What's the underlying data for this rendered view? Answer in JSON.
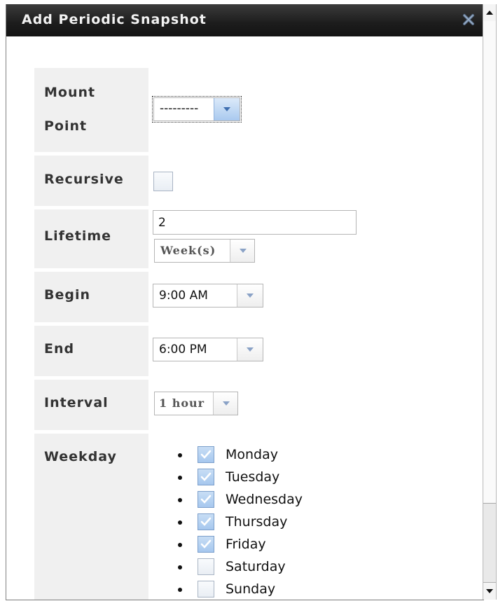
{
  "dialog": {
    "title": "Add Periodic Snapshot"
  },
  "form": {
    "mount_point": {
      "label_line1": "Mount",
      "label_line2": "Point",
      "value": "---------"
    },
    "recursive": {
      "label": "Recursive",
      "checked": false
    },
    "lifetime": {
      "label": "Lifetime",
      "value": "2",
      "unit": "Week(s)"
    },
    "begin": {
      "label": "Begin",
      "value": "9:00 AM"
    },
    "end": {
      "label": "End",
      "value": "6:00 PM"
    },
    "interval": {
      "label": "Interval",
      "value": "1 hour"
    },
    "weekday": {
      "label": "Weekday",
      "days": [
        {
          "name": "Monday",
          "checked": true
        },
        {
          "name": "Tuesday",
          "checked": true
        },
        {
          "name": "Wednesday",
          "checked": true
        },
        {
          "name": "Thursday",
          "checked": true
        },
        {
          "name": "Friday",
          "checked": true
        },
        {
          "name": "Saturday",
          "checked": false
        },
        {
          "name": "Sunday",
          "checked": false
        }
      ]
    }
  },
  "colors": {
    "titlebar": "#1c1c1c",
    "label_background": "#f0f0f0",
    "checkbox_checked": "#a6c7ee",
    "dropdown_arrow": "#8aa2c6"
  }
}
